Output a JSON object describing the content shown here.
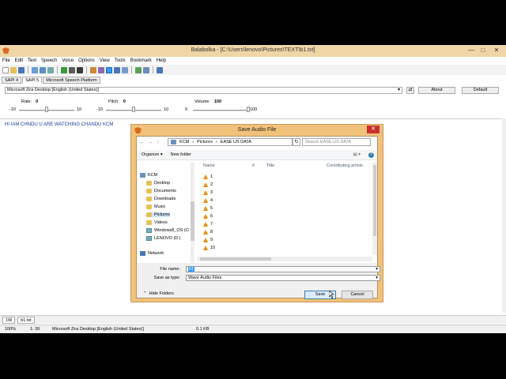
{
  "window": {
    "title": "Balabolka - [C:\\Users\\lenovo\\Pictures\\TEXT\\b1.txt]",
    "minimize": "—",
    "maximize": "□",
    "close": "✕"
  },
  "menu": [
    "File",
    "Edit",
    "Text",
    "Speech",
    "Voice",
    "Options",
    "View",
    "Tools",
    "Bookmark",
    "Help"
  ],
  "api_tabs": [
    "SAPI 4",
    "SAPI 5",
    "Microsoft Speech Platform"
  ],
  "voice": {
    "selected": "Microsoft Zira Desktop [English (United States)]",
    "about_label": "About",
    "default_label": "Default"
  },
  "sliders": {
    "rate": {
      "label": "Rate:",
      "value": "0",
      "min": "-10",
      "max": "10",
      "level": 0.5
    },
    "pitch": {
      "label": "Pitch:",
      "value": "0",
      "min": "-10",
      "max": "10",
      "level": 0.5
    },
    "volume": {
      "label": "Volume:",
      "value": "100",
      "min": "0",
      "max": "100",
      "level": 1.0
    }
  },
  "editor": {
    "text": "HI IAM CHNDU U ARE WATCHING CHANDU KCM"
  },
  "doc_tabs": [
    "1W",
    "b1.txt"
  ],
  "status": {
    "zoom": "100%",
    "position": "1:  39",
    "voice": "Microsoft Zira Desktop [English (United States)]",
    "size": "0.1 KB"
  },
  "dialog": {
    "title": "Save Audio File",
    "close": "✕",
    "breadcrumbs": [
      "KCM",
      "Pictures",
      "EASE US DATA"
    ],
    "search_placeholder": "Search EASE US DATA",
    "organize": "Organize ▾",
    "new_folder": "New folder",
    "nav_items": [
      "KCM",
      "Desktop",
      "Documents",
      "Downloads",
      "Music",
      "Pictures",
      "Videos",
      "Windows8_OS (C",
      "LENOVO (D:)",
      "Network"
    ],
    "columns": [
      "Name",
      "#",
      "Title",
      "Contributing artists"
    ],
    "files": [
      "1",
      "2",
      "3",
      "4",
      "5",
      "6",
      "7",
      "8",
      "9",
      "10"
    ],
    "file_name_label": "File name:",
    "file_name_value": "b1",
    "save_type_label": "Save as type:",
    "save_type_value": "Wave Audio Files",
    "hide_folders": "Hide Folders",
    "save": "Save",
    "cancel": "Cancel"
  },
  "colors": {
    "titlebar": "#f0d6a6",
    "dialog_frame": "#f1c27a",
    "editor_text": "#1a3d99",
    "close_red": "#c9302c"
  }
}
